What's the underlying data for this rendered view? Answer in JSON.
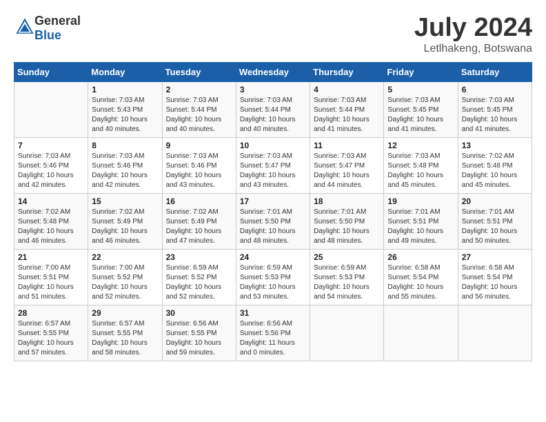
{
  "logo": {
    "general": "General",
    "blue": "Blue"
  },
  "title": {
    "month_year": "July 2024",
    "location": "Letlhakeng, Botswana"
  },
  "weekdays": [
    "Sunday",
    "Monday",
    "Tuesday",
    "Wednesday",
    "Thursday",
    "Friday",
    "Saturday"
  ],
  "weeks": [
    [
      {
        "day": null,
        "detail": null
      },
      {
        "day": "1",
        "detail": "Sunrise: 7:03 AM\nSunset: 5:43 PM\nDaylight: 10 hours\nand 40 minutes."
      },
      {
        "day": "2",
        "detail": "Sunrise: 7:03 AM\nSunset: 5:44 PM\nDaylight: 10 hours\nand 40 minutes."
      },
      {
        "day": "3",
        "detail": "Sunrise: 7:03 AM\nSunset: 5:44 PM\nDaylight: 10 hours\nand 40 minutes."
      },
      {
        "day": "4",
        "detail": "Sunrise: 7:03 AM\nSunset: 5:44 PM\nDaylight: 10 hours\nand 41 minutes."
      },
      {
        "day": "5",
        "detail": "Sunrise: 7:03 AM\nSunset: 5:45 PM\nDaylight: 10 hours\nand 41 minutes."
      },
      {
        "day": "6",
        "detail": "Sunrise: 7:03 AM\nSunset: 5:45 PM\nDaylight: 10 hours\nand 41 minutes."
      }
    ],
    [
      {
        "day": "7",
        "detail": "Sunrise: 7:03 AM\nSunset: 5:46 PM\nDaylight: 10 hours\nand 42 minutes."
      },
      {
        "day": "8",
        "detail": "Sunrise: 7:03 AM\nSunset: 5:46 PM\nDaylight: 10 hours\nand 42 minutes."
      },
      {
        "day": "9",
        "detail": "Sunrise: 7:03 AM\nSunset: 5:46 PM\nDaylight: 10 hours\nand 43 minutes."
      },
      {
        "day": "10",
        "detail": "Sunrise: 7:03 AM\nSunset: 5:47 PM\nDaylight: 10 hours\nand 43 minutes."
      },
      {
        "day": "11",
        "detail": "Sunrise: 7:03 AM\nSunset: 5:47 PM\nDaylight: 10 hours\nand 44 minutes."
      },
      {
        "day": "12",
        "detail": "Sunrise: 7:03 AM\nSunset: 5:48 PM\nDaylight: 10 hours\nand 45 minutes."
      },
      {
        "day": "13",
        "detail": "Sunrise: 7:02 AM\nSunset: 5:48 PM\nDaylight: 10 hours\nand 45 minutes."
      }
    ],
    [
      {
        "day": "14",
        "detail": "Sunrise: 7:02 AM\nSunset: 5:48 PM\nDaylight: 10 hours\nand 46 minutes."
      },
      {
        "day": "15",
        "detail": "Sunrise: 7:02 AM\nSunset: 5:49 PM\nDaylight: 10 hours\nand 46 minutes."
      },
      {
        "day": "16",
        "detail": "Sunrise: 7:02 AM\nSunset: 5:49 PM\nDaylight: 10 hours\nand 47 minutes."
      },
      {
        "day": "17",
        "detail": "Sunrise: 7:01 AM\nSunset: 5:50 PM\nDaylight: 10 hours\nand 48 minutes."
      },
      {
        "day": "18",
        "detail": "Sunrise: 7:01 AM\nSunset: 5:50 PM\nDaylight: 10 hours\nand 48 minutes."
      },
      {
        "day": "19",
        "detail": "Sunrise: 7:01 AM\nSunset: 5:51 PM\nDaylight: 10 hours\nand 49 minutes."
      },
      {
        "day": "20",
        "detail": "Sunrise: 7:01 AM\nSunset: 5:51 PM\nDaylight: 10 hours\nand 50 minutes."
      }
    ],
    [
      {
        "day": "21",
        "detail": "Sunrise: 7:00 AM\nSunset: 5:51 PM\nDaylight: 10 hours\nand 51 minutes."
      },
      {
        "day": "22",
        "detail": "Sunrise: 7:00 AM\nSunset: 5:52 PM\nDaylight: 10 hours\nand 52 minutes."
      },
      {
        "day": "23",
        "detail": "Sunrise: 6:59 AM\nSunset: 5:52 PM\nDaylight: 10 hours\nand 52 minutes."
      },
      {
        "day": "24",
        "detail": "Sunrise: 6:59 AM\nSunset: 5:53 PM\nDaylight: 10 hours\nand 53 minutes."
      },
      {
        "day": "25",
        "detail": "Sunrise: 6:59 AM\nSunset: 5:53 PM\nDaylight: 10 hours\nand 54 minutes."
      },
      {
        "day": "26",
        "detail": "Sunrise: 6:58 AM\nSunset: 5:54 PM\nDaylight: 10 hours\nand 55 minutes."
      },
      {
        "day": "27",
        "detail": "Sunrise: 6:58 AM\nSunset: 5:54 PM\nDaylight: 10 hours\nand 56 minutes."
      }
    ],
    [
      {
        "day": "28",
        "detail": "Sunrise: 6:57 AM\nSunset: 5:55 PM\nDaylight: 10 hours\nand 57 minutes."
      },
      {
        "day": "29",
        "detail": "Sunrise: 6:57 AM\nSunset: 5:55 PM\nDaylight: 10 hours\nand 58 minutes."
      },
      {
        "day": "30",
        "detail": "Sunrise: 6:56 AM\nSunset: 5:55 PM\nDaylight: 10 hours\nand 59 minutes."
      },
      {
        "day": "31",
        "detail": "Sunrise: 6:56 AM\nSunset: 5:56 PM\nDaylight: 11 hours\nand 0 minutes."
      },
      {
        "day": null,
        "detail": null
      },
      {
        "day": null,
        "detail": null
      },
      {
        "day": null,
        "detail": null
      }
    ]
  ]
}
